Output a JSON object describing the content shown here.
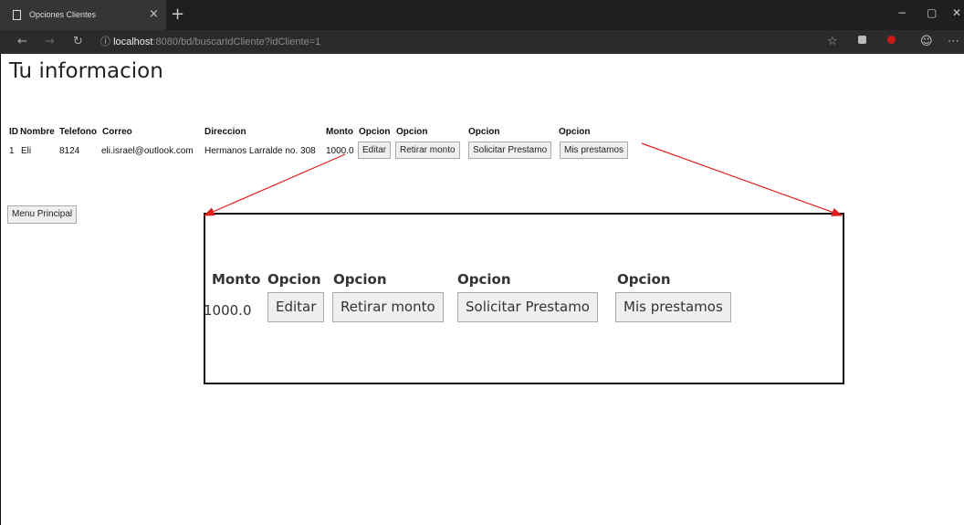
{
  "browser": {
    "tab_title": "Opciones Clientes",
    "tab_close": "×",
    "new_tab": "+",
    "url_prefix": "ⓘ",
    "url_host": "localhost",
    "url_path": ":8080/bd/buscarIdCliente?idCliente=1"
  },
  "page": {
    "title": "Tu informacion"
  },
  "table": {
    "headers": [
      "ID",
      "Nombre",
      "Telefono",
      "Correo",
      "Direccion",
      "Monto",
      "Opcion",
      "Opcion",
      "Opcion",
      "Opcion"
    ],
    "row": {
      "id": "1",
      "nombre": "Eli",
      "telefono": "8124",
      "correo": "eli.israel@outlook.com",
      "direccion": "Hermanos Larralde no. 308",
      "monto": "1000.0"
    },
    "buttons": {
      "editar": "Editar",
      "retirar": "Retirar monto",
      "solicitar": "Solicitar Prestamo",
      "prestamos": "Mis prestamos"
    }
  },
  "menu_button": "Menu Principal",
  "zoom": {
    "headers": [
      "Monto",
      "Opcion",
      "Opcion",
      "Opcion",
      "Opcion"
    ],
    "monto": "1000.0",
    "buttons": [
      "Editar",
      "Retirar monto",
      "Solicitar Prestamo",
      "Mis prestamos"
    ]
  },
  "colors": {
    "chrome_dark": "#1f1f1f",
    "chrome_nav": "#2b2b2b",
    "arrow": "#e02020"
  }
}
